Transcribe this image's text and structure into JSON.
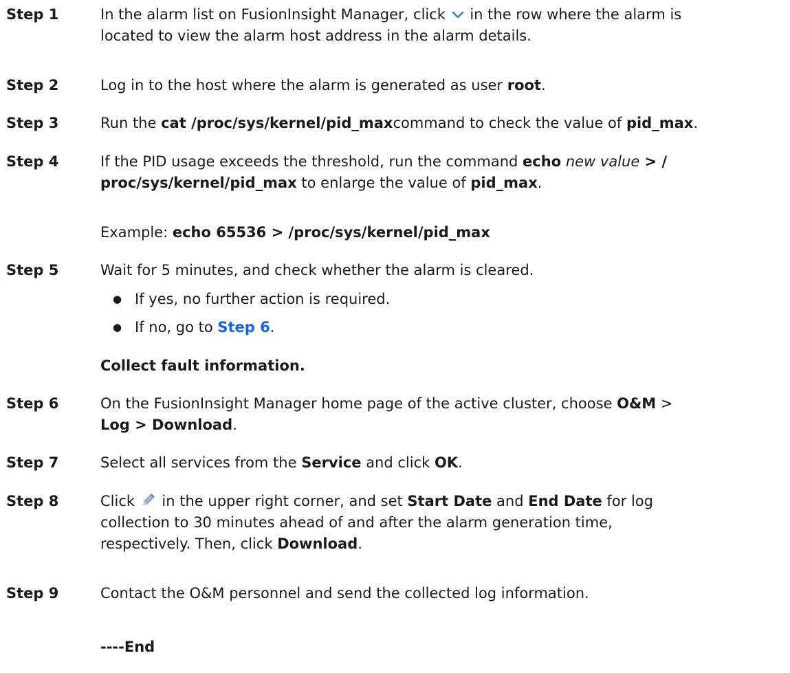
{
  "steps": [
    {
      "label": "Step 1",
      "s1_a": "In the alarm list on FusionInsight Manager, click",
      "s1_b": "in the row where the alarm is",
      "s1_c": "located to view the alarm host address in the alarm details."
    },
    {
      "label": "Step 2",
      "a": "Log in to the host where the alarm is generated as user ",
      "b": "root",
      "c": "."
    },
    {
      "label": "Step 3",
      "a": "Run the ",
      "b": "cat /proc/sys/kernel/pid_max",
      "c": "command to check the value of ",
      "d": "pid_max",
      "e": "."
    },
    {
      "label": "Step 4",
      "a": "If the PID usage exceeds the threshold, run the command ",
      "b": "echo",
      "c": "new value",
      "d": " > /",
      "e": "proc/sys/kernel/pid_max",
      "f": " to enlarge the value of ",
      "g": "pid_max",
      "h": ".",
      "example_label": "Example: ",
      "example_cmd": "echo 65536 > /proc/sys/kernel/pid_max"
    },
    {
      "label": "Step 5",
      "a": "Wait for 5 minutes, and check whether the alarm is cleared.",
      "bullet1": "If yes, no further action is required.",
      "bullet2_a": "If no, go to ",
      "bullet2_link": "Step 6",
      "bullet2_c": "."
    },
    {
      "label": "Step 6",
      "a": "On the FusionInsight Manager home page of the active cluster, choose ",
      "b": "O&M",
      "c": " >",
      "d": "Log > Download",
      "e": "."
    },
    {
      "label": "Step 7",
      "a": "Select all services from the ",
      "b": "Service",
      "c": " and click ",
      "d": "OK",
      "e": "."
    },
    {
      "label": "Step 8",
      "a": "Click",
      "b": "in the upper right corner, and set ",
      "c": "Start Date",
      "d": " and ",
      "e": "End Date",
      "f": " for log",
      "g": "collection to 30 minutes ahead of and after the alarm generation time,",
      "h": "respectively. Then, click ",
      "i": "Download",
      "j": "."
    },
    {
      "label": "Step 9",
      "a": "Contact the O&M personnel and send the collected log information."
    }
  ],
  "section_heading": "Collect fault information.",
  "end_marker": "----End",
  "bullet_glyph": "●",
  "icons": {
    "chevron": "chevron-down-icon",
    "pencil": "pencil-edit-icon"
  }
}
